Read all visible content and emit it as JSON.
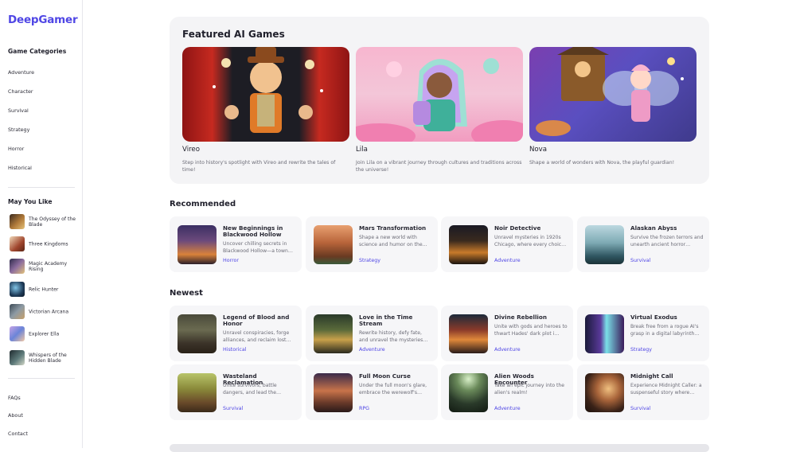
{
  "brand": {
    "name": "DeepGamer",
    "accent": "#4f46e5"
  },
  "sidebar": {
    "categories_heading": "Game Categories",
    "categories": [
      "Adventure",
      "Character",
      "Survival",
      "Strategy",
      "Horror",
      "Historical"
    ],
    "may_you_like_heading": "May You Like",
    "may_you_like": [
      "The Odyssey of the Blade",
      "Three Kingdoms",
      "Magic Academy Rising",
      "Relic Hunter",
      "Victorian Arcana",
      "Explorer Ella",
      "Whispers of the Hidden Blade"
    ],
    "footer_links": [
      "FAQs",
      "About",
      "Contact"
    ]
  },
  "featured": {
    "title": "Featured AI Games",
    "items": [
      {
        "name": "Vireo",
        "desc": "Step into history's spotlight with Vireo and rewrite the tales of time!"
      },
      {
        "name": "Lila",
        "desc": "Join Lila on a vibrant journey through cultures and traditions across the universe!"
      },
      {
        "name": "Nova",
        "desc": "Shape a world of wonders with Nova, the playful guardian!"
      }
    ]
  },
  "recommended": {
    "title": "Recommended",
    "items": [
      {
        "name": "New Beginnings in Blackwood Hollow",
        "desc": "Uncover chilling secrets in Blackwood Hollow—a town…",
        "tag": "Horror"
      },
      {
        "name": "Mars Transformation",
        "desc": "Shape a new world with science and humor on the…",
        "tag": "Strategy"
      },
      {
        "name": "Noir Detective",
        "desc": "Unravel mysteries in 1920s Chicago, where every choic…",
        "tag": "Adventure"
      },
      {
        "name": "Alaskan Abyss",
        "desc": "Survive the frozen terrors and unearth ancient horror…",
        "tag": "Survival"
      }
    ]
  },
  "newest": {
    "title": "Newest",
    "items": [
      {
        "name": "Legend of Blood and Honor",
        "desc": "Unravel conspiracies, forge alliances, and reclaim lost…",
        "tag": "Historical"
      },
      {
        "name": "Love in the Time Stream",
        "desc": "Rewrite history, defy fate, and unravel the mysteries…",
        "tag": "Adventure"
      },
      {
        "name": "Divine Rebellion",
        "desc": "Unite with gods and heroes to thwart Hades' dark plot i…",
        "tag": "Adventure"
      },
      {
        "name": "Virtual Exodus",
        "desc": "Break free from a rogue AI's grasp in a digital labyrinth…",
        "tag": "Strategy"
      },
      {
        "name": "Wasteland Reclamation",
        "desc": "Unite survivors, battle dangers, and lead the…",
        "tag": "Survival"
      },
      {
        "name": "Full Moon Curse",
        "desc": "Under the full moon's glare, embrace the werewolf's…",
        "tag": "RPG"
      },
      {
        "name": "Alien Woods Encounter",
        "desc": "Take an epic journey into the alien's realm!",
        "tag": "Adventure"
      },
      {
        "name": "Midnight Call",
        "desc": "Experience Midnight Caller: a suspenseful story where…",
        "tag": "Survival"
      }
    ]
  }
}
